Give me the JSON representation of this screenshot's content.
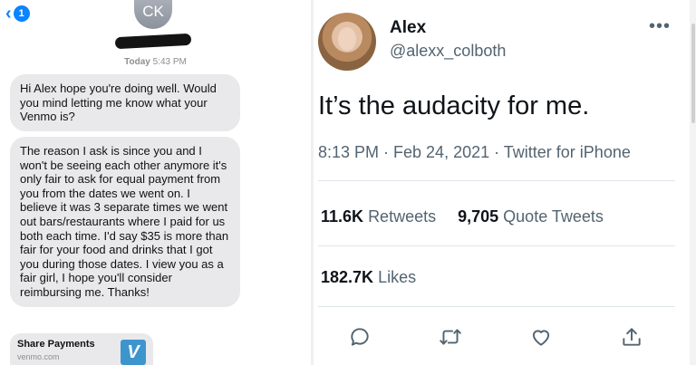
{
  "messages_app": {
    "back_badge": "1",
    "contact_initials": "CK",
    "timestamp_day": "Today",
    "timestamp_time": "5:43 PM",
    "messages": [
      "Hi Alex hope you're doing well. Would you mind letting me know what your Venmo is?",
      "The reason I ask is since you and I won't be seeing each other anymore it's only fair to ask for equal payment from you from the dates we went on. I believe it was 3 separate times we went out bars/restaurants where I paid for us both each time. I'd say $35 is more than fair for your food and drinks that I got you during those dates. I view you as a fair girl, I hope you'll consider reimbursing me. Thanks!"
    ],
    "link_preview": {
      "title": "Share Payments",
      "domain": "venmo.com",
      "logo_letter": "V",
      "logo_color": "#3d95ce"
    },
    "bubble_color": "#e9e9eb",
    "accent": "#0a84ff"
  },
  "tweet": {
    "display_name": "Alex",
    "handle": "@alexx_colboth",
    "more_icon": "more-horizontal-icon",
    "text": "It’s the audacity for me.",
    "meta": "8:13 PM · Feb 24, 2021 · Twitter for iPhone",
    "retweets_count": "11.6K",
    "retweets_label": "Retweets",
    "quote_count": "9,705",
    "quote_label": "Quote Tweets",
    "likes_count": "182.7K",
    "likes_label": "Likes",
    "actions": [
      "reply-icon",
      "retweet-icon",
      "like-icon",
      "share-icon"
    ],
    "icon_color": "#536471"
  }
}
